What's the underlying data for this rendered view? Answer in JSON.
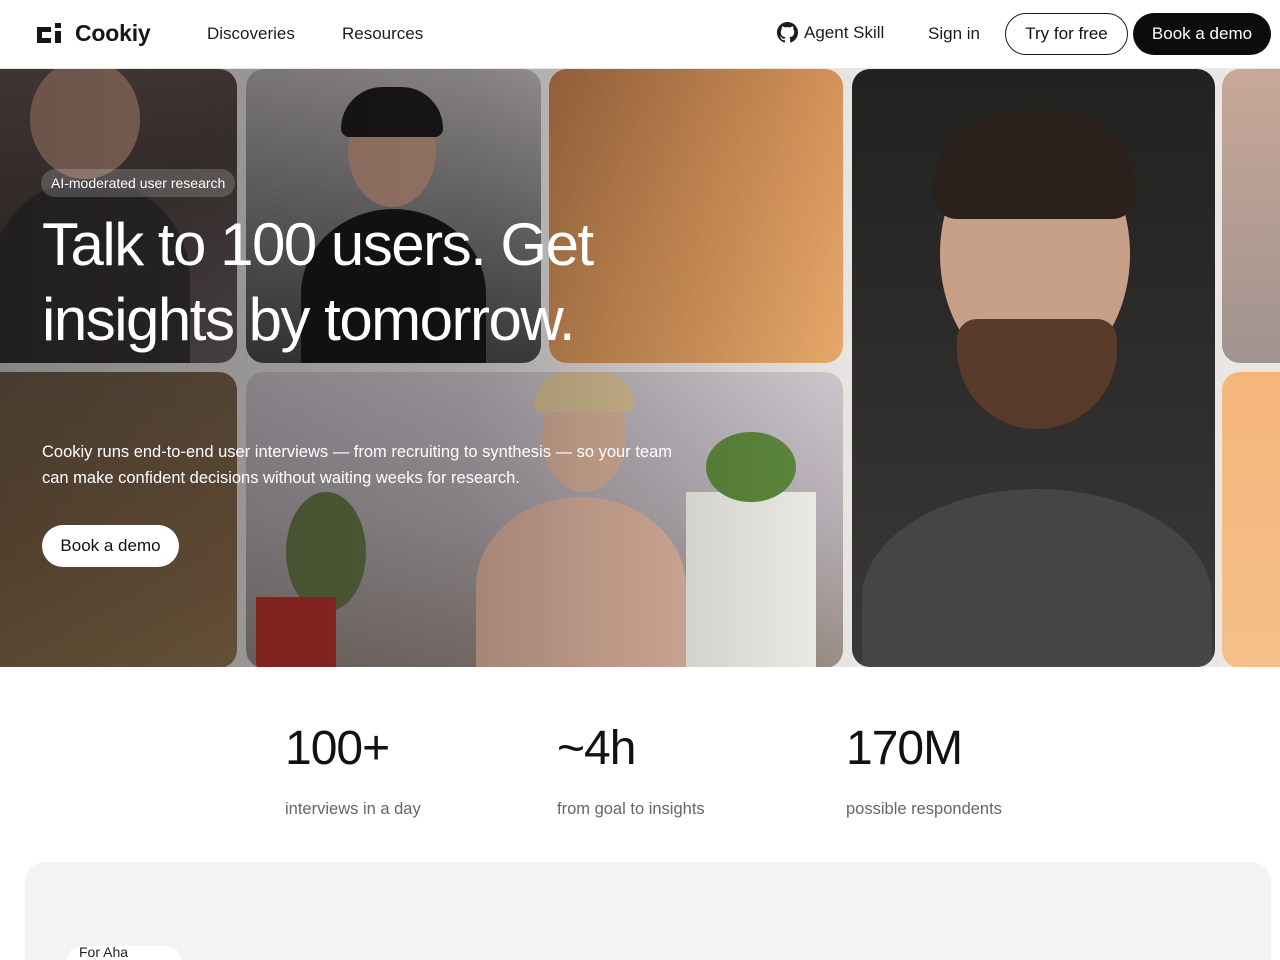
{
  "brand": {
    "name": "Cookiy",
    "logo_icon": "cookiy-logo-icon"
  },
  "nav": {
    "links": [
      "Discoveries",
      "Resources"
    ],
    "github_label": "Agent Skill",
    "github_icon": "github-icon",
    "sign_in": "Sign in",
    "try_free": "Try for free",
    "book_demo": "Book a demo"
  },
  "hero": {
    "badge": "AI-moderated user research",
    "headline": "Talk to 100 users. Get insights by tomorrow.",
    "subtext": "Cookiy runs end-to-end user interviews — from recruiting to synthesis — so your team can make confident decisions without waiting weeks for research.",
    "cta": "Book a demo"
  },
  "stats": [
    {
      "value": "100+",
      "label": "interviews in a day"
    },
    {
      "value": "~4h",
      "label": "from goal to insights"
    },
    {
      "value": "170M",
      "label": "possible respondents"
    }
  ],
  "next_section": {
    "pill": "For Aha moments"
  },
  "colors": {
    "primary": "#0c0c0c",
    "background": "#ffffff",
    "section_bg": "#f4f3f1",
    "accent_orange": "#d49258"
  }
}
